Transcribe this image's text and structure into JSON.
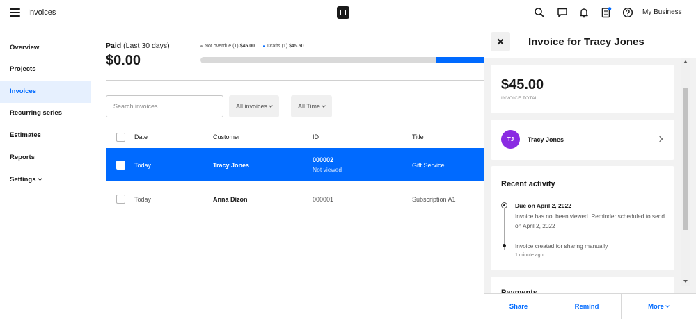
{
  "topbar": {
    "title": "Invoices",
    "business_name": "My Business",
    "icons": [
      "menu-icon",
      "square-logo",
      "search-icon",
      "chat-icon",
      "bell-icon",
      "invoice-icon",
      "help-icon"
    ]
  },
  "sidebar": {
    "items": [
      {
        "label": "Overview"
      },
      {
        "label": "Projects"
      },
      {
        "label": "Invoices",
        "active": true
      },
      {
        "label": "Recurring series"
      },
      {
        "label": "Estimates"
      },
      {
        "label": "Reports"
      },
      {
        "label": "Settings"
      }
    ]
  },
  "summary": {
    "paid_label": "Paid",
    "paid_period": "(Last 30 days)",
    "paid_amount": "$0.00",
    "legend": [
      {
        "label": "Not overdue (1)",
        "amount": "$45.00",
        "color": "#999999"
      },
      {
        "label": "Drafts (1)",
        "amount": "$45.50",
        "color": "#006aff"
      }
    ],
    "progress_drafts_fraction": 0.17
  },
  "filters": {
    "search_placeholder": "Search invoices",
    "status": "All invoices",
    "time": "All Time"
  },
  "table": {
    "columns": [
      "Date",
      "Customer",
      "ID",
      "Title"
    ],
    "rows": [
      {
        "date": "Today",
        "customer": "Tracy Jones",
        "id": "000002",
        "id_status": "Not viewed",
        "title": "Gift Service",
        "selected": true
      },
      {
        "date": "Today",
        "customer": "Anna Dizon",
        "id": "000001",
        "id_status": "",
        "title": "Subscription A1",
        "selected": false
      }
    ]
  },
  "panel": {
    "title": "Invoice for Tracy Jones",
    "total_amount": "$45.00",
    "total_label": "INVOICE TOTAL",
    "customer_initials": "TJ",
    "customer_name": "Tracy Jones",
    "avatar_color": "#8a2be2",
    "activity_title": "Recent activity",
    "activity": [
      {
        "title": "Due on April 2, 2022",
        "description": "Invoice has not been viewed. Reminder scheduled to send on April 2, 2022"
      },
      {
        "title": "Invoice created for sharing manually",
        "time": "1 minute ago"
      }
    ],
    "payments_title": "Payments",
    "footer": {
      "share": "Share",
      "remind": "Remind",
      "more": "More"
    }
  },
  "colors": {
    "accent": "#006aff",
    "active_nav_bg": "#e6f0fe"
  }
}
